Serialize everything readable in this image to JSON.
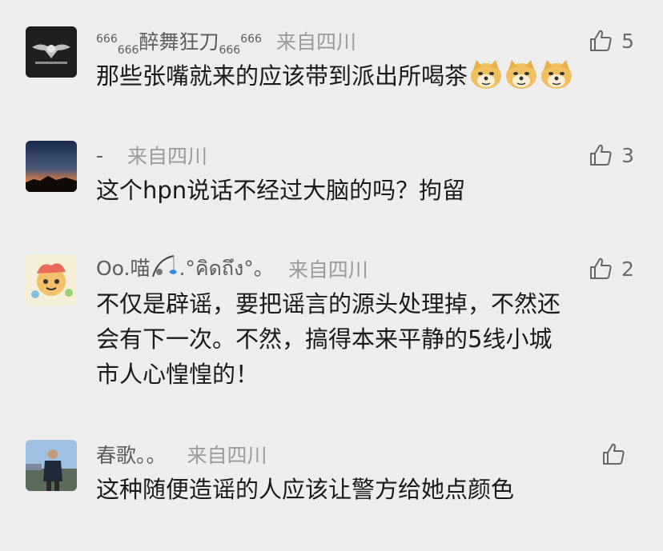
{
  "comments": [
    {
      "name_sup_left": "666",
      "name_sub_left": "666",
      "name_main": "醉舞狂刀",
      "name_sub_right": "666",
      "name_sup_right": "666",
      "location": "来自四川",
      "likes": "5",
      "text": "那些张嘴就来的应该带到派出所喝茶",
      "emoji": [
        "doge-emoji",
        "doge-emoji",
        "doge-emoji"
      ]
    },
    {
      "name": "-",
      "location": "来自四川",
      "likes": "3",
      "text": "这个hpn说话不经过大脑的吗？拘留"
    },
    {
      "name_prefix": "Oo.喵",
      "name_suffix": ".°คิดถึง°。",
      "name_emoji": "fishing-emoji",
      "location": "来自四川",
      "likes": "2",
      "text_lines": [
        "不仅是辟谣，要把谣言的源头处理掉，不然还",
        "会有下一次。不然，搞得本来平静的5线小城",
        "市人心惶惶的！"
      ]
    },
    {
      "name": "春歌。。",
      "location": "来自四川",
      "likes": "",
      "text": "这种随便造谣的人应该让警方给她点颜色"
    }
  ],
  "icons": {
    "like": "thumbs-up-icon"
  }
}
